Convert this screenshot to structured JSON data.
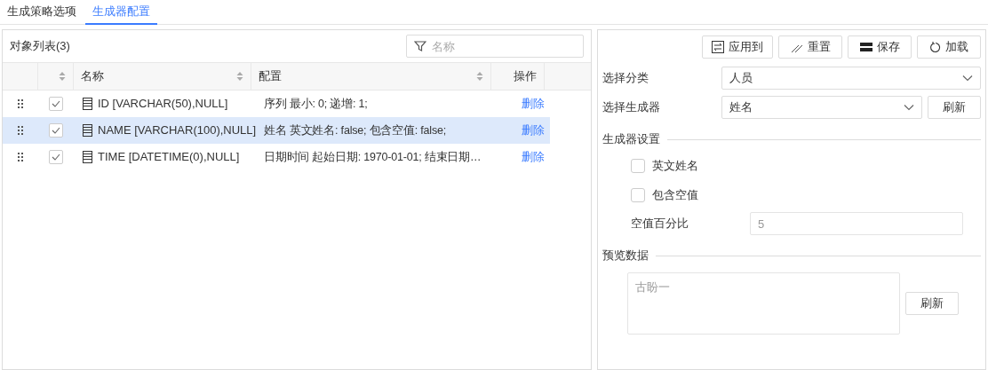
{
  "tabs": [
    {
      "label": "生成策略选项",
      "selected": false
    },
    {
      "label": "生成器配置",
      "selected": true
    }
  ],
  "object_list": {
    "title": "对象列表(3)",
    "search": {
      "placeholder": "名称"
    },
    "columns": [
      "名称",
      "配置",
      "操作"
    ],
    "rows": [
      {
        "checked": true,
        "selected": false,
        "name": "ID [VARCHAR(50),NULL]",
        "config": "序列 最小: 0; 递增: 1;",
        "action": "删除"
      },
      {
        "checked": true,
        "selected": true,
        "name": "NAME [VARCHAR(100),NULL]",
        "config": "姓名 英文姓名: false; 包含空值: false;",
        "action": "删除"
      },
      {
        "checked": true,
        "selected": false,
        "name": "TIME [DATETIME(0),NULL]",
        "config": "日期时间 起始日期: 1970-01-01; 结束日期…",
        "action": "删除"
      }
    ]
  },
  "toolbar": [
    {
      "kind": "apply",
      "label": "应用到"
    },
    {
      "kind": "reset",
      "label": "重置"
    },
    {
      "kind": "save",
      "label": "保存"
    },
    {
      "kind": "load",
      "label": "加载"
    }
  ],
  "category": {
    "label": "选择分类",
    "value": "人员"
  },
  "generator": {
    "label": "选择生成器",
    "value": "姓名",
    "button": "刷新"
  },
  "settings": {
    "title": "生成器设置",
    "options": [
      {
        "label": "英文姓名",
        "checked": false
      },
      {
        "label": "包含空值",
        "checked": false
      }
    ],
    "null_percent": {
      "label": "空值百分比",
      "value": "5",
      "disabled": true
    }
  },
  "preview": {
    "title": "预览数据",
    "value": "古盼一",
    "button": "刷新"
  }
}
